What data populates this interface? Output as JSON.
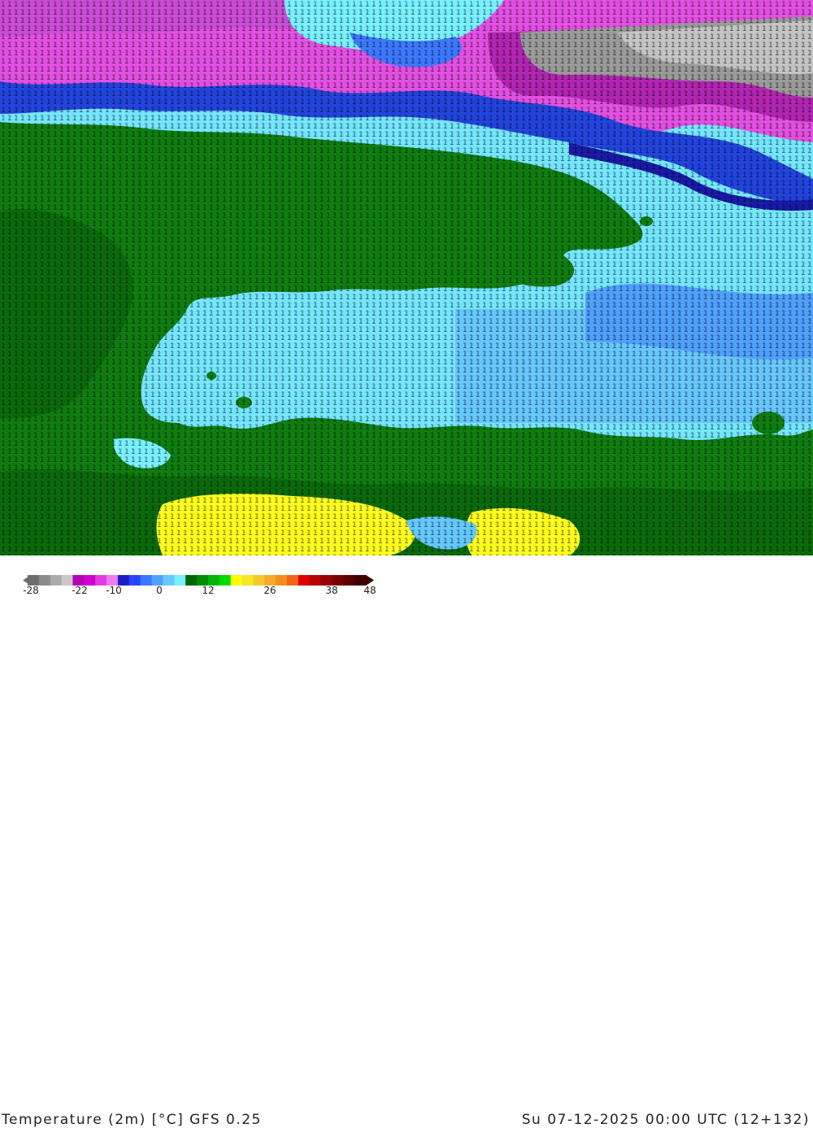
{
  "title": {
    "left": "Temperature (2m) [°C] GFS 0.25",
    "right": "Su 07-12-2025 00:00 UTC (12+132)"
  },
  "colorbar": {
    "tick_labels": [
      "-28",
      "-22",
      "-10",
      "0",
      "12",
      "26",
      "38",
      "48"
    ],
    "colors": [
      "#6e6e6e",
      "#8c8c8c",
      "#aaaaaa",
      "#c8c8c8",
      "#b400b4",
      "#d000d0",
      "#e23be2",
      "#f078f0",
      "#1e1ec8",
      "#2846ff",
      "#3c78ff",
      "#50a0ff",
      "#64c8ff",
      "#78f0ff",
      "#006400",
      "#008c00",
      "#00b400",
      "#00dc00",
      "#ffff00",
      "#f5e628",
      "#f5c828",
      "#f5aa28",
      "#f58c1e",
      "#f06414",
      "#dc0000",
      "#b40000",
      "#960000",
      "#780000",
      "#5a0000",
      "#3c0000"
    ]
  },
  "map": {
    "description_colors": {
      "sea_cold": "#6fe3ff",
      "sea_warm": "#7ff0ff",
      "land": "#0f7d10",
      "land_dark": "#0a6a0b",
      "snow_magenta": "#e84de8",
      "snow_purple": "#b020b0",
      "deep_blue": "#2030d8",
      "grey": "#9a9a9a",
      "yellow": "#ffff1e"
    },
    "sample_digits": "2222233333333444555555544433322211111000000000112223334445556667778889998877665544433322211110000011112222333344445555"
  }
}
